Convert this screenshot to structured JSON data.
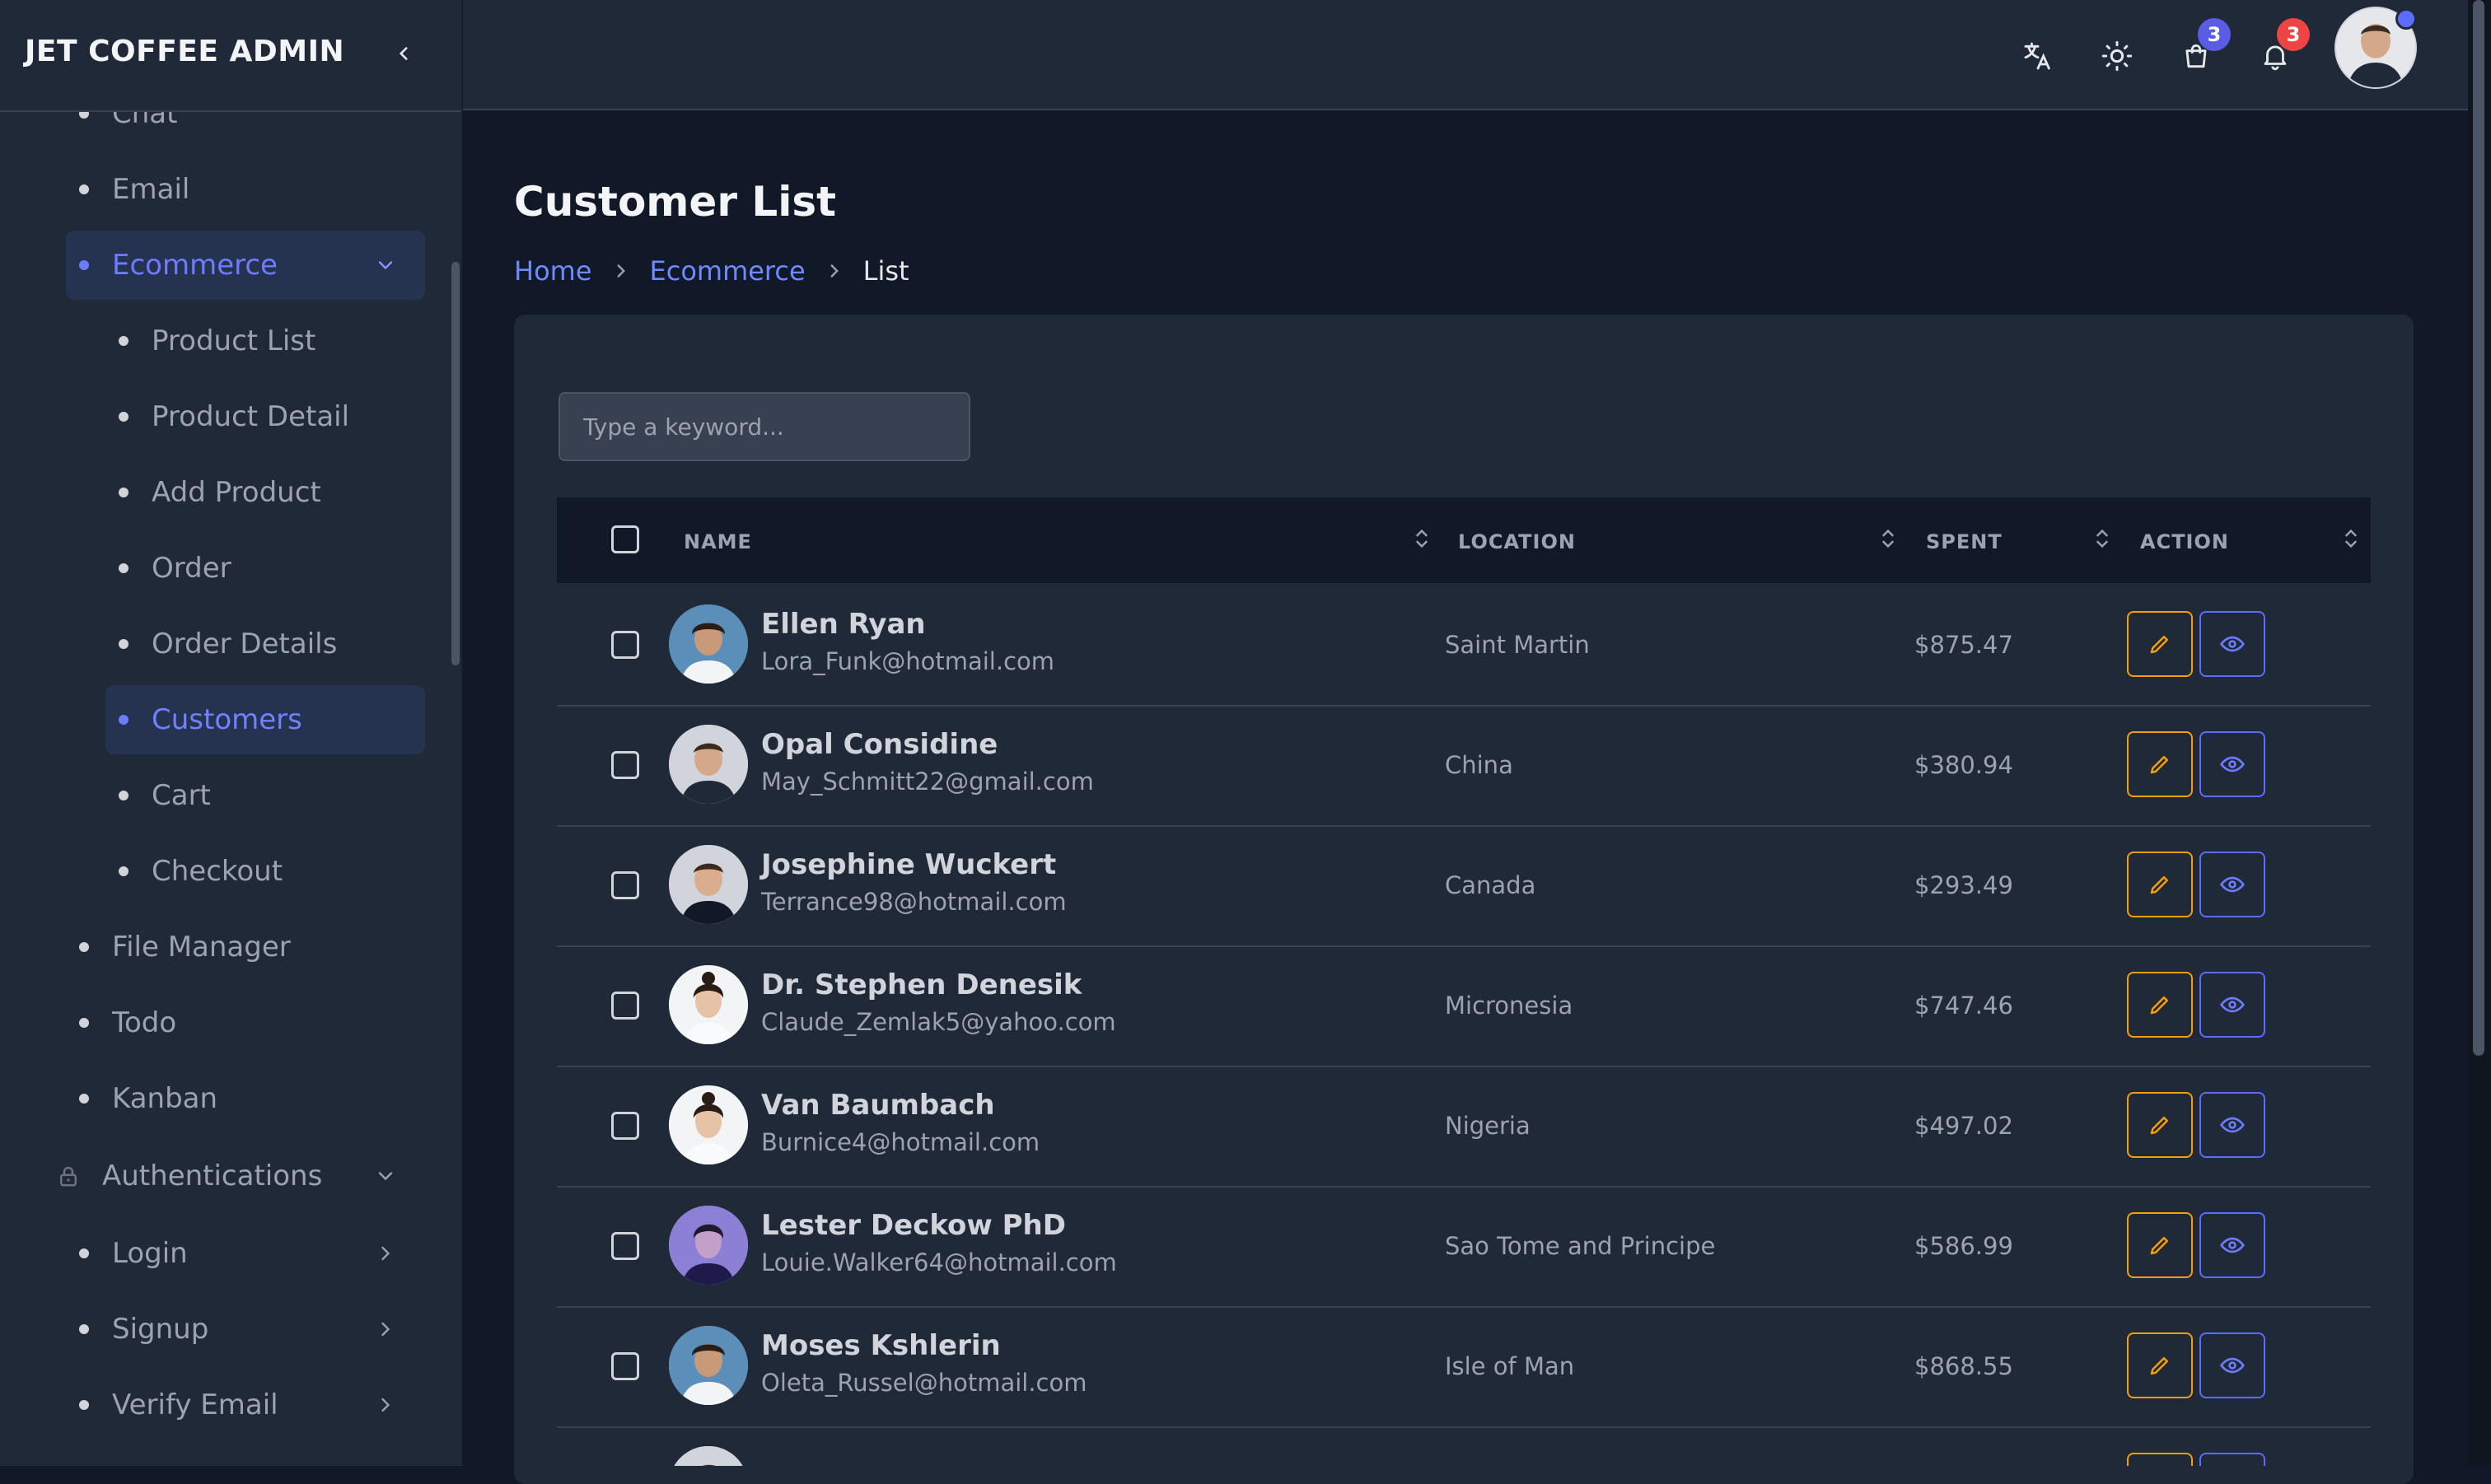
{
  "app": {
    "brand": "JET COFFEE ADMIN"
  },
  "sidebar": {
    "items": [
      {
        "label": "Chat"
      },
      {
        "label": "Email"
      },
      {
        "label": "Ecommerce"
      },
      {
        "label": "Product List"
      },
      {
        "label": "Product Detail"
      },
      {
        "label": "Add Product"
      },
      {
        "label": "Order"
      },
      {
        "label": "Order Details"
      },
      {
        "label": "Customers"
      },
      {
        "label": "Cart"
      },
      {
        "label": "Checkout"
      },
      {
        "label": "File Manager"
      },
      {
        "label": "Todo"
      },
      {
        "label": "Kanban"
      },
      {
        "label": "Authentications"
      },
      {
        "label": "Login"
      },
      {
        "label": "Signup"
      },
      {
        "label": "Verify Email"
      }
    ]
  },
  "header": {
    "cart_count": "3",
    "notification_count": "3",
    "icons": [
      "translate-icon",
      "sun-icon",
      "shopping-bag-icon",
      "bell-icon"
    ],
    "badge_colors": {
      "cart": "#5b5ce6",
      "notifications": "#ef4444"
    }
  },
  "page": {
    "title": "Customer List",
    "breadcrumb": [
      "Home",
      "Ecommerce",
      "List"
    ]
  },
  "search": {
    "placeholder": "Type a keyword..."
  },
  "table": {
    "columns": [
      "NAME",
      "LOCATION",
      "SPENT",
      "ACTION"
    ],
    "rows": [
      {
        "name": "Ellen Ryan",
        "email": "Lora_Funk@hotmail.com",
        "location": "Saint Martin",
        "spent": "$875.47"
      },
      {
        "name": "Opal Considine",
        "email": "May_Schmitt22@gmail.com",
        "location": "China",
        "spent": "$380.94"
      },
      {
        "name": "Josephine Wuckert",
        "email": "Terrance98@hotmail.com",
        "location": "Canada",
        "spent": "$293.49"
      },
      {
        "name": "Dr. Stephen Denesik",
        "email": "Claude_Zemlak5@yahoo.com",
        "location": "Micronesia",
        "spent": "$747.46"
      },
      {
        "name": "Van Baumbach",
        "email": "Burnice4@hotmail.com",
        "location": "Nigeria",
        "spent": "$497.02"
      },
      {
        "name": "Lester Deckow PhD",
        "email": "Louie.Walker64@hotmail.com",
        "location": "Sao Tome and Principe",
        "spent": "$586.99"
      },
      {
        "name": "Moses Kshlerin",
        "email": "Oleta_Russel@hotmail.com",
        "location": "Isle of Man",
        "spent": "$868.55"
      }
    ]
  },
  "colors": {
    "accent": "#6d7cff",
    "edit": "#f59e0b",
    "view": "#5b6cff",
    "background": "#111827",
    "panel": "#1f2937"
  }
}
